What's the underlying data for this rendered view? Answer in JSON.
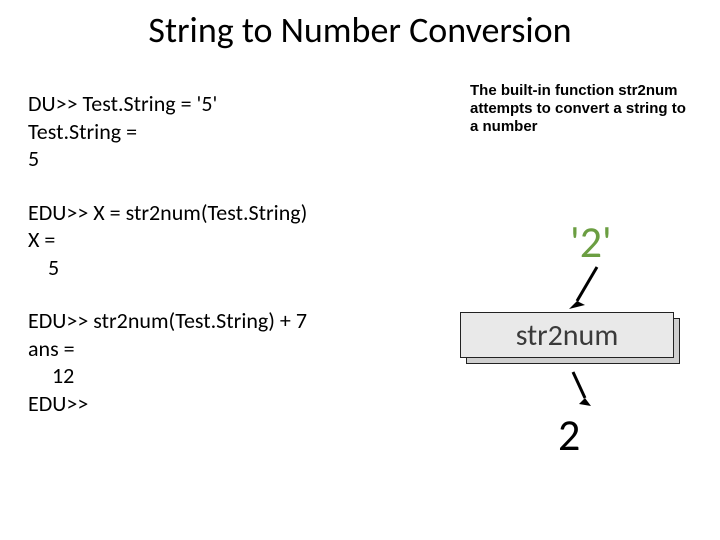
{
  "title": "String to Number Conversion",
  "left": {
    "block1": {
      "l1": "DU>> Test.String = '5'",
      "l2": "Test.String =",
      "l3": "5"
    },
    "block2": {
      "l1": "EDU>> X = str2num(Test.String)",
      "l2": "X =",
      "l3": "5"
    },
    "block3": {
      "l1": "EDU>> str2num(Test.String) + 7",
      "l2": "ans =",
      "l3": "12",
      "l4": "EDU>>"
    }
  },
  "note": "The built-in function str2num attempts to convert a string to a number",
  "diagram": {
    "input": "'2'",
    "func": "str2num",
    "output": "2"
  }
}
